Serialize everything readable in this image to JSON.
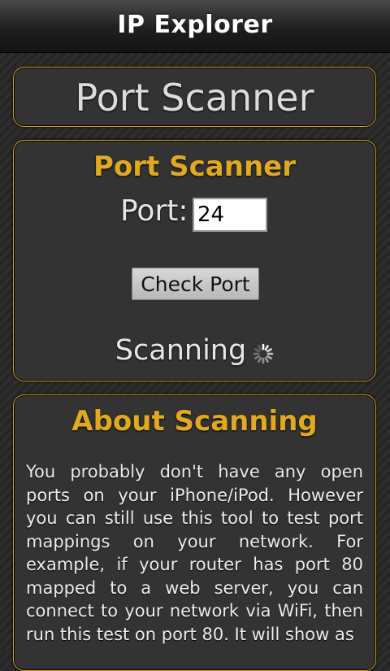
{
  "app": {
    "title": "IP Explorer"
  },
  "header": {
    "title": "Port Scanner"
  },
  "scanner": {
    "title": "Port Scanner",
    "port_label": "Port:",
    "port_value": "24",
    "check_button": "Check Port",
    "status_text": "Scanning",
    "status_icon": "spinner-icon"
  },
  "about": {
    "title": "About Scanning",
    "text": "You probably don't have any open ports on your iPhone/iPod. However you can still use this tool to test port mappings on your network. For example, if your router has port 80 mapped to a web server, you can connect to your network via WiFi, then run this test on port 80. It will show as"
  },
  "colors": {
    "accent": "#e0a91f",
    "panel": "#333333",
    "topbar": "#1e1e1e"
  }
}
